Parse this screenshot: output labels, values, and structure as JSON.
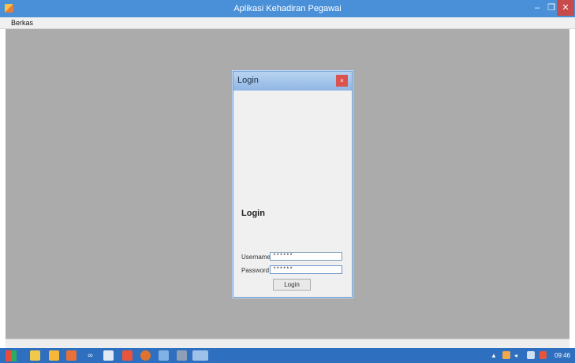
{
  "window": {
    "title": "Aplikasi Kehadiran Pegawai",
    "minimize_symbol": "–",
    "maximize_symbol": "❐",
    "close_symbol": "✕"
  },
  "menu": {
    "items": [
      "Berkas"
    ]
  },
  "login_dialog": {
    "title": "Login",
    "close_symbol": "×",
    "heading": "Login",
    "username_label": "Username",
    "username_value": "******",
    "password_label": "Password",
    "password_value": "******",
    "login_button": "Login"
  },
  "taskbar": {
    "icons": [
      "start-icon",
      "explorer-icon",
      "paint-icon",
      "app-icon",
      "infinity-icon",
      "shield-icon",
      "flash-icon",
      "firefox-icon",
      "notepad-icon",
      "terminal-icon",
      "active-app-icon"
    ],
    "tray_arrow": "▲",
    "clock": "09:46"
  },
  "colors": {
    "titlebar": "#4a90d9",
    "workspace": "#ababab",
    "taskbar": "#2f6fc0",
    "close_red": "#c84b4b"
  }
}
